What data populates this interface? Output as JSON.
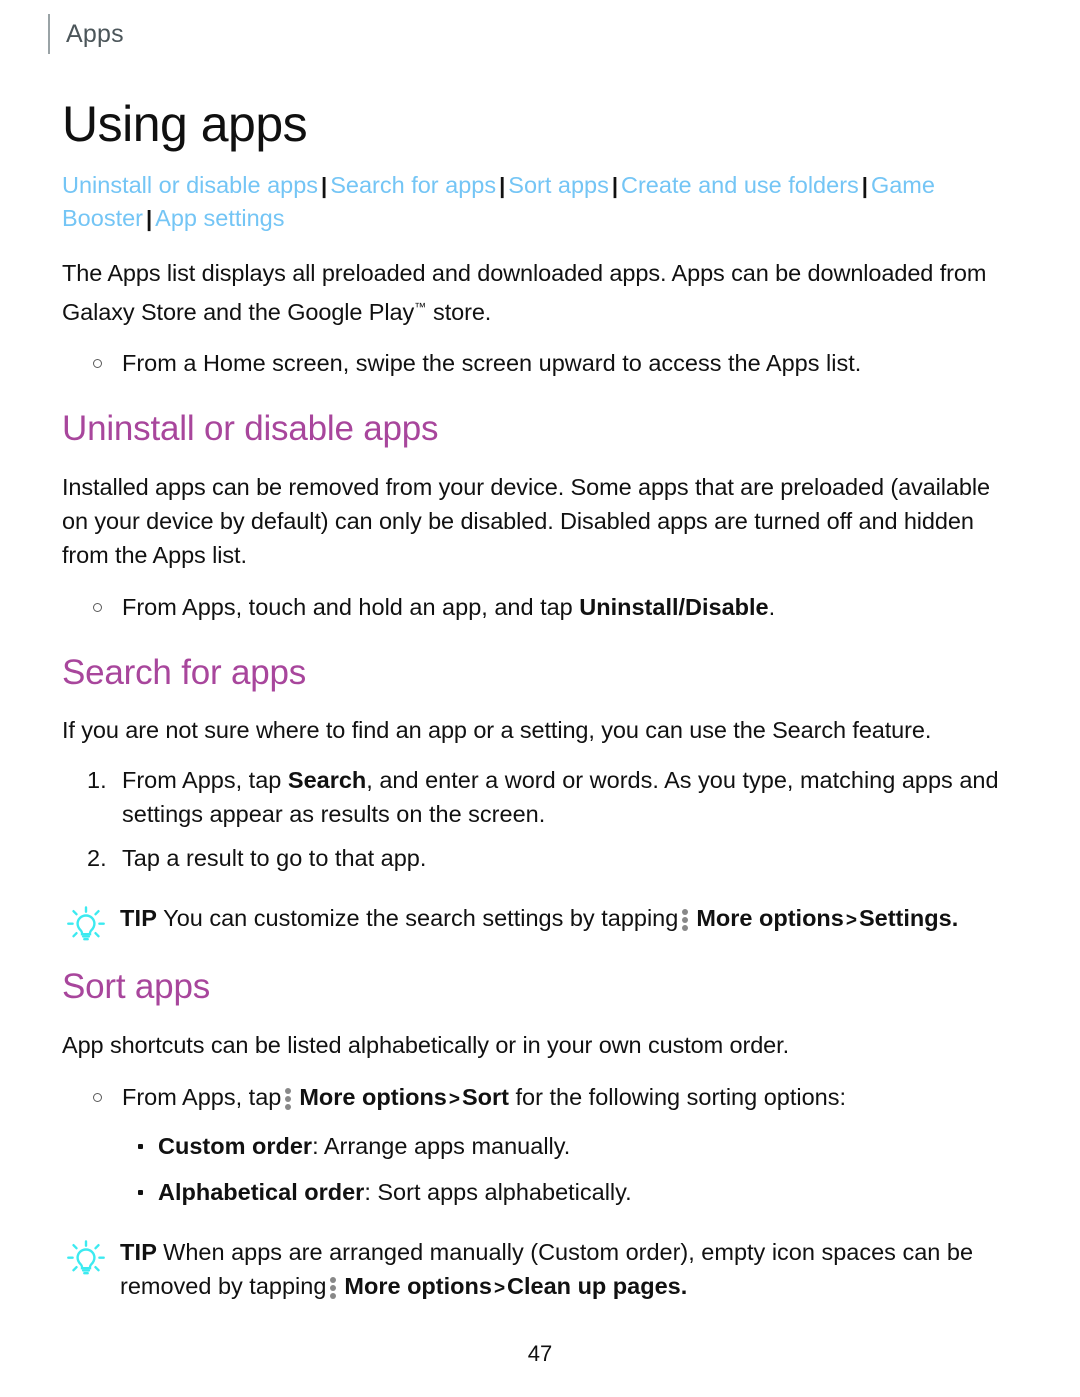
{
  "header": {
    "running_label": "Apps"
  },
  "title": "Using apps",
  "nav": {
    "separator": "|",
    "links": [
      "Uninstall or disable apps",
      "Search for apps",
      "Sort apps",
      "Create and use folders",
      "Game Booster",
      "App settings"
    ]
  },
  "intro": {
    "paragraph_a": "The Apps list displays all preloaded and downloaded apps. Apps can be downloaded from Galaxy Store and the Google Play",
    "trademark": "™",
    "paragraph_b": " store.",
    "bullet": "From a Home screen, swipe the screen upward to access the Apps list."
  },
  "sections": {
    "uninstall": {
      "heading": "Uninstall or disable apps",
      "body": "Installed apps can be removed from your device. Some apps that are preloaded (available on your device by default) can only be disabled. Disabled apps are turned off and hidden from the Apps list.",
      "bullet_a": "From Apps, touch and hold an app, and tap ",
      "bullet_b": "Uninstall/Disable",
      "bullet_c": "."
    },
    "search": {
      "heading": "Search for apps",
      "body": "If you are not sure where to find an app or a setting, you can use the Search feature.",
      "step1_a": "From Apps, tap ",
      "step1_bold": "Search",
      "step1_b": ", and enter a word or words. As you type, matching apps and settings appear as results on the screen.",
      "step2": "Tap a result to go to that app.",
      "tip": {
        "label": "TIP",
        "text_a": "You can customize the search settings by tapping",
        "more_options": "More options",
        "caret": ">",
        "target": "Settings",
        "text_b": "."
      }
    },
    "sort": {
      "heading": "Sort apps",
      "body": "App shortcuts can be listed alphabetically or in your own custom order.",
      "bullet_a": "From Apps, tap",
      "bullet_more_options": "More options",
      "bullet_caret": ">",
      "bullet_sort": "Sort",
      "bullet_b": " for the following sorting options:",
      "options": [
        {
          "name": "Custom order",
          "desc": ": Arrange apps manually."
        },
        {
          "name": "Alphabetical order",
          "desc": ": Sort apps alphabetically."
        }
      ],
      "tip": {
        "label": "TIP",
        "text_a": "When apps are arranged manually (Custom order), empty icon spaces can be removed by tapping",
        "more_options": "More options",
        "caret": ">",
        "target": "Clean up pages",
        "text_b": "."
      }
    }
  },
  "footer": {
    "page_number": "47"
  },
  "colors": {
    "link": "#74c5f5",
    "heading": "#a8469c",
    "tip_icon": "#3ceaf0",
    "dots_icon": "#888888",
    "body_text": "#111111",
    "running_header": "#4c565a"
  },
  "icons": {
    "tip": "lightbulb-icon",
    "more_options": "more-options-vertical-dots-icon"
  }
}
